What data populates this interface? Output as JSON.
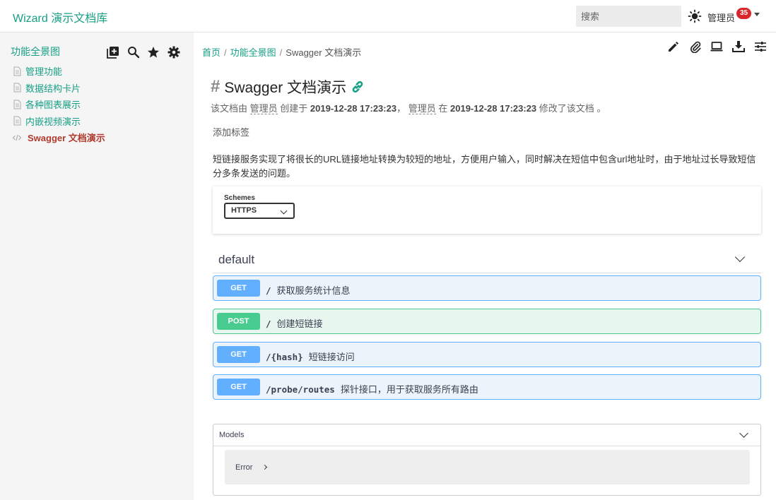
{
  "header": {
    "brand": "Wizard 演示文档库",
    "search_placeholder": "搜索",
    "user_name": "管理员",
    "notification_count": "35"
  },
  "sidebar": {
    "title": "功能全景图",
    "tools": [
      "add-page-icon",
      "search-icon",
      "star-icon",
      "gear-icon"
    ],
    "items": [
      {
        "label": "管理功能",
        "icon": "document-icon"
      },
      {
        "label": "数据结构卡片",
        "icon": "document-icon"
      },
      {
        "label": "各种图表展示",
        "icon": "document-icon"
      },
      {
        "label": "内嵌视频演示",
        "icon": "document-icon"
      },
      {
        "label": "Swagger 文档演示",
        "icon": "code-icon",
        "active": true
      }
    ]
  },
  "breadcrumb": {
    "home": "首页",
    "parent": "功能全景图",
    "current": "Swagger 文档演示",
    "separator": "/"
  },
  "toolbar": [
    "edit-icon",
    "attachment-icon",
    "present-icon",
    "download-icon",
    "settings-sliders-icon"
  ],
  "document": {
    "hash": "#",
    "title": "Swagger 文档演示",
    "meta_prefix": "该文档由",
    "creator": "管理员",
    "created_label": "创建于",
    "created_at": "2019-12-28 17:23:23",
    "comma": "，",
    "modifier": "管理员",
    "at_label": "在",
    "modified_at": "2019-12-28 17:23:23",
    "modified_suffix": "修改了该文档 。",
    "add_tag": "添加标签",
    "description": "短链接服务实现了将很长的URL链接地址转换为较短的地址，方便用户输入，同时解决在短信中包含url地址时，由于地址过长导致短信分多条发送的问题。"
  },
  "swagger": {
    "schemes_label": "Schemes",
    "scheme_selected": "HTTPS",
    "tag": "default",
    "operations": [
      {
        "method": "GET",
        "path": "/",
        "summary": "获取服务统计信息"
      },
      {
        "method": "POST",
        "path": "/",
        "summary": "创建短链接"
      },
      {
        "method": "GET",
        "path": "/{hash}",
        "summary": "短链接访问"
      },
      {
        "method": "GET",
        "path": "/probe/routes",
        "summary": "探针接口，用于获取服务所有路由"
      }
    ],
    "models_title": "Models",
    "models": [
      "Error"
    ]
  },
  "colors": {
    "brand": "#17a085",
    "active": "#b03a2e",
    "get": "#61affe",
    "post": "#49cc90",
    "badge": "#d9262c"
  }
}
